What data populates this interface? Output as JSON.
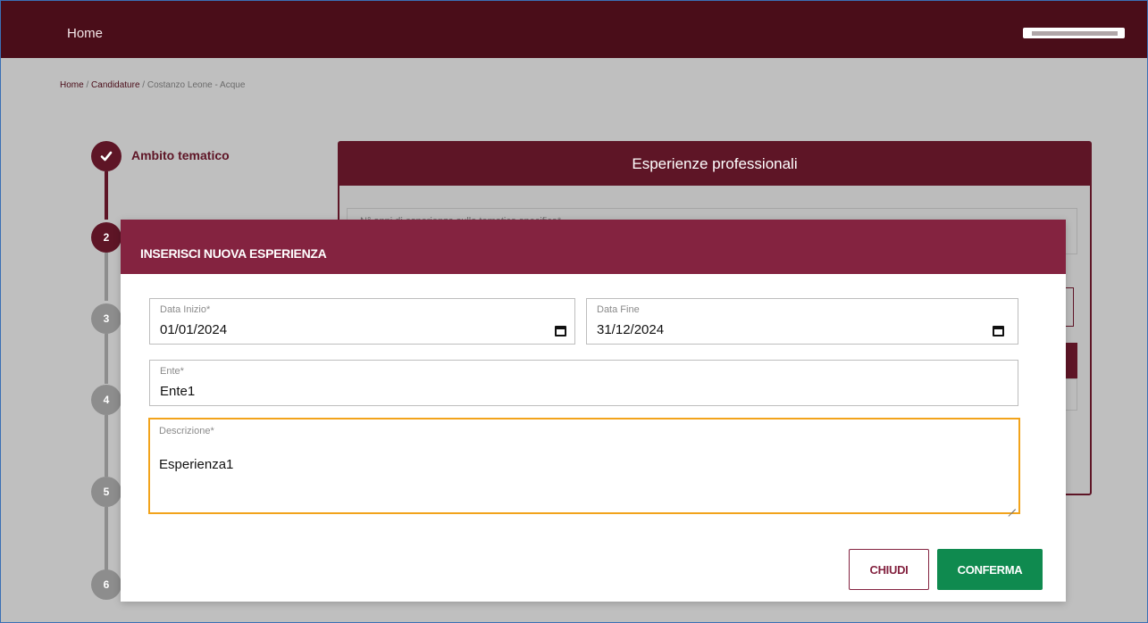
{
  "navbar": {
    "home_label": "Home"
  },
  "breadcrumb": {
    "home": "Home",
    "sep1": " / ",
    "candidature": "Candidature",
    "sep2": " / ",
    "current": "Costanzo Leone - Acque"
  },
  "stepper": {
    "steps": [
      {
        "label": "Ambito tematico",
        "state": "done"
      },
      {
        "number": "2",
        "state": "active"
      },
      {
        "number": "3",
        "state": "todo"
      },
      {
        "number": "4",
        "state": "todo"
      },
      {
        "number": "5",
        "state": "todo"
      },
      {
        "number": "6",
        "state": "todo"
      }
    ],
    "done_icon": "check-icon"
  },
  "background_card": {
    "title": "Esperienze professionali",
    "field_label": "N° anni di esperienza sulla tematica specifica*"
  },
  "modal": {
    "title": "INSERISCI NUOVA ESPERIENZA",
    "data_inizio": {
      "label": "Data Inizio*",
      "value": "01/01/2024"
    },
    "data_fine": {
      "label": "Data Fine",
      "value": "31/12/2024"
    },
    "ente": {
      "label": "Ente*",
      "value": "Ente1"
    },
    "descrizione": {
      "label": "Descrizione*",
      "value": "Esperienza1"
    },
    "close_label": "CHIUDI",
    "confirm_label": "CONFERMA"
  },
  "colors": {
    "navbar": "#4a0d19",
    "primary": "#5e1526",
    "modal_header": "#842340",
    "confirm": "#0f8a4f",
    "focus_border": "#f2a31b"
  }
}
